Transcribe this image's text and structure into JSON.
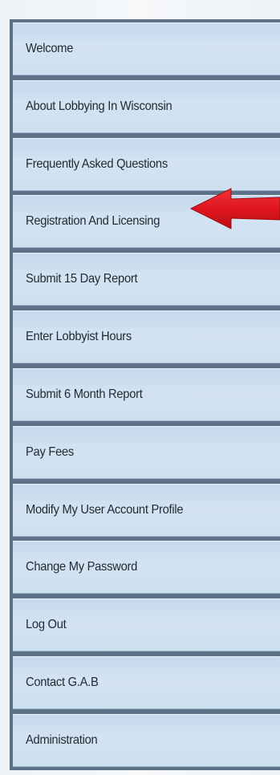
{
  "nav_menu": {
    "items": [
      {
        "label": "Welcome"
      },
      {
        "label": "About Lobbying In Wisconsin"
      },
      {
        "label": "Frequently Asked Questions"
      },
      {
        "label": "Registration And Licensing"
      },
      {
        "label": "Submit 15 Day Report"
      },
      {
        "label": "Enter Lobbyist Hours"
      },
      {
        "label": "Submit 6 Month Report"
      },
      {
        "label": "Pay Fees"
      },
      {
        "label": "Modify My User Account Profile"
      },
      {
        "label": "Change My Password"
      },
      {
        "label": "Log Out"
      },
      {
        "label": "Contact G.A.B"
      },
      {
        "label": "Administration"
      }
    ]
  },
  "annotation": {
    "arrow_color": "#e0151d",
    "points_to": "Registration And Licensing",
    "icon": "left-arrow-icon"
  },
  "colors": {
    "menu_item_bg": "#d3e3f2",
    "menu_border": "#5b7288",
    "text": "#222a33"
  }
}
